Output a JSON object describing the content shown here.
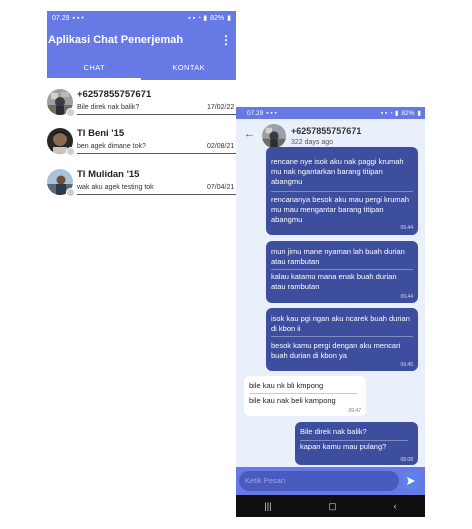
{
  "list_screen": {
    "status": {
      "time": "07.29",
      "battery": "82%"
    },
    "app_title": "Aplikasi Chat Penerjemah",
    "menu_glyph": "⋮",
    "tabs": [
      {
        "label": "CHAT",
        "selected": true
      },
      {
        "label": "KONTAK",
        "selected": false
      }
    ],
    "chats": [
      {
        "name": "+6257855757671",
        "last_message": "Bile direk nak balik?",
        "date": "17/02/22"
      },
      {
        "name": "TI Beni '15",
        "last_message": "ben agek dimane tok?",
        "date": "02/08/21"
      },
      {
        "name": "TI Mulidan '15",
        "last_message": "wak aku agek testing tok",
        "date": "07/04/21"
      }
    ]
  },
  "chat_screen": {
    "status": {
      "time": "07.29",
      "battery": "82%"
    },
    "contact_name": "+6257855757671",
    "contact_subtitle": "322 days ago",
    "messages": [
      {
        "dir": "out",
        "lines": [
          "rencane nye isok aku nak paggi krumah mu nak ngantarkan barang titipan abangmu",
          "rencananya besok aku mau pergi krumah mu mau mengantar barang titipan abangmu"
        ],
        "time": "09.44"
      },
      {
        "dir": "out",
        "lines": [
          "mun jimu mane nyaman lah buah durian atau rambutan",
          "kalau katamu mana enak buah durian atau rambutan"
        ],
        "time": "09.44"
      },
      {
        "dir": "out",
        "lines": [
          "isok kau pgi ngan aku ncarek buah durian di kbon ii",
          "besok kamu pergi dengan aku mencari buah durian di kbon ya"
        ],
        "time": "09.45"
      },
      {
        "dir": "in",
        "lines": [
          "bile kau nk bli kmpong",
          "bile kau nak beli kampong"
        ],
        "time": "09.47"
      },
      {
        "dir": "out",
        "lines": [
          "Bile direk nak balik?",
          "kapan kamu mau pulang?"
        ],
        "time": "08.08"
      }
    ],
    "composer_placeholder": "Ketik Pesan",
    "nav_icons": [
      "recents-icon",
      "home-icon",
      "back-icon"
    ]
  }
}
